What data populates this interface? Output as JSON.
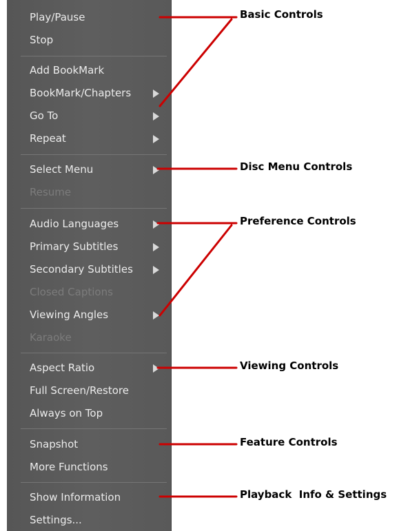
{
  "menu": {
    "items": [
      {
        "label": "Play/Pause",
        "arrow": false,
        "disabled": false
      },
      {
        "label": "Stop",
        "arrow": false,
        "disabled": false
      },
      {
        "label": "Add BookMark",
        "arrow": false,
        "disabled": false
      },
      {
        "label": "BookMark/Chapters",
        "arrow": true,
        "disabled": false
      },
      {
        "label": "Go To",
        "arrow": true,
        "disabled": false
      },
      {
        "label": "Repeat",
        "arrow": true,
        "disabled": false
      },
      {
        "label": "Select Menu",
        "arrow": true,
        "disabled": false
      },
      {
        "label": "Resume",
        "arrow": false,
        "disabled": true
      },
      {
        "label": "Audio Languages",
        "arrow": true,
        "disabled": false
      },
      {
        "label": "Primary Subtitles",
        "arrow": true,
        "disabled": false
      },
      {
        "label": "Secondary Subtitles",
        "arrow": true,
        "disabled": false
      },
      {
        "label": "Closed Captions",
        "arrow": false,
        "disabled": true
      },
      {
        "label": "Viewing Angles",
        "arrow": true,
        "disabled": false
      },
      {
        "label": "Karaoke",
        "arrow": false,
        "disabled": true
      },
      {
        "label": "Aspect Ratio",
        "arrow": true,
        "disabled": false
      },
      {
        "label": "Full Screen/Restore",
        "arrow": false,
        "disabled": false
      },
      {
        "label": "Always on Top",
        "arrow": false,
        "disabled": false
      },
      {
        "label": "Snapshot",
        "arrow": false,
        "disabled": false
      },
      {
        "label": "More Functions",
        "arrow": false,
        "disabled": false
      },
      {
        "label": "Show Information",
        "arrow": false,
        "disabled": false
      },
      {
        "label": "Settings...",
        "arrow": false,
        "disabled": false
      }
    ]
  },
  "annotations": {
    "basic": "Basic Controls",
    "disc_menu": "Disc Menu Controls",
    "preference": "Preference Controls",
    "viewing": "Viewing Controls",
    "feature": "Feature Controls",
    "playback": "Playback  Info & Settings"
  },
  "colors": {
    "menu_background": "#5a5a5a",
    "enabled_text": "#ececec",
    "disabled_text": "#7c7c7c",
    "callout_line": "#cc0000"
  }
}
